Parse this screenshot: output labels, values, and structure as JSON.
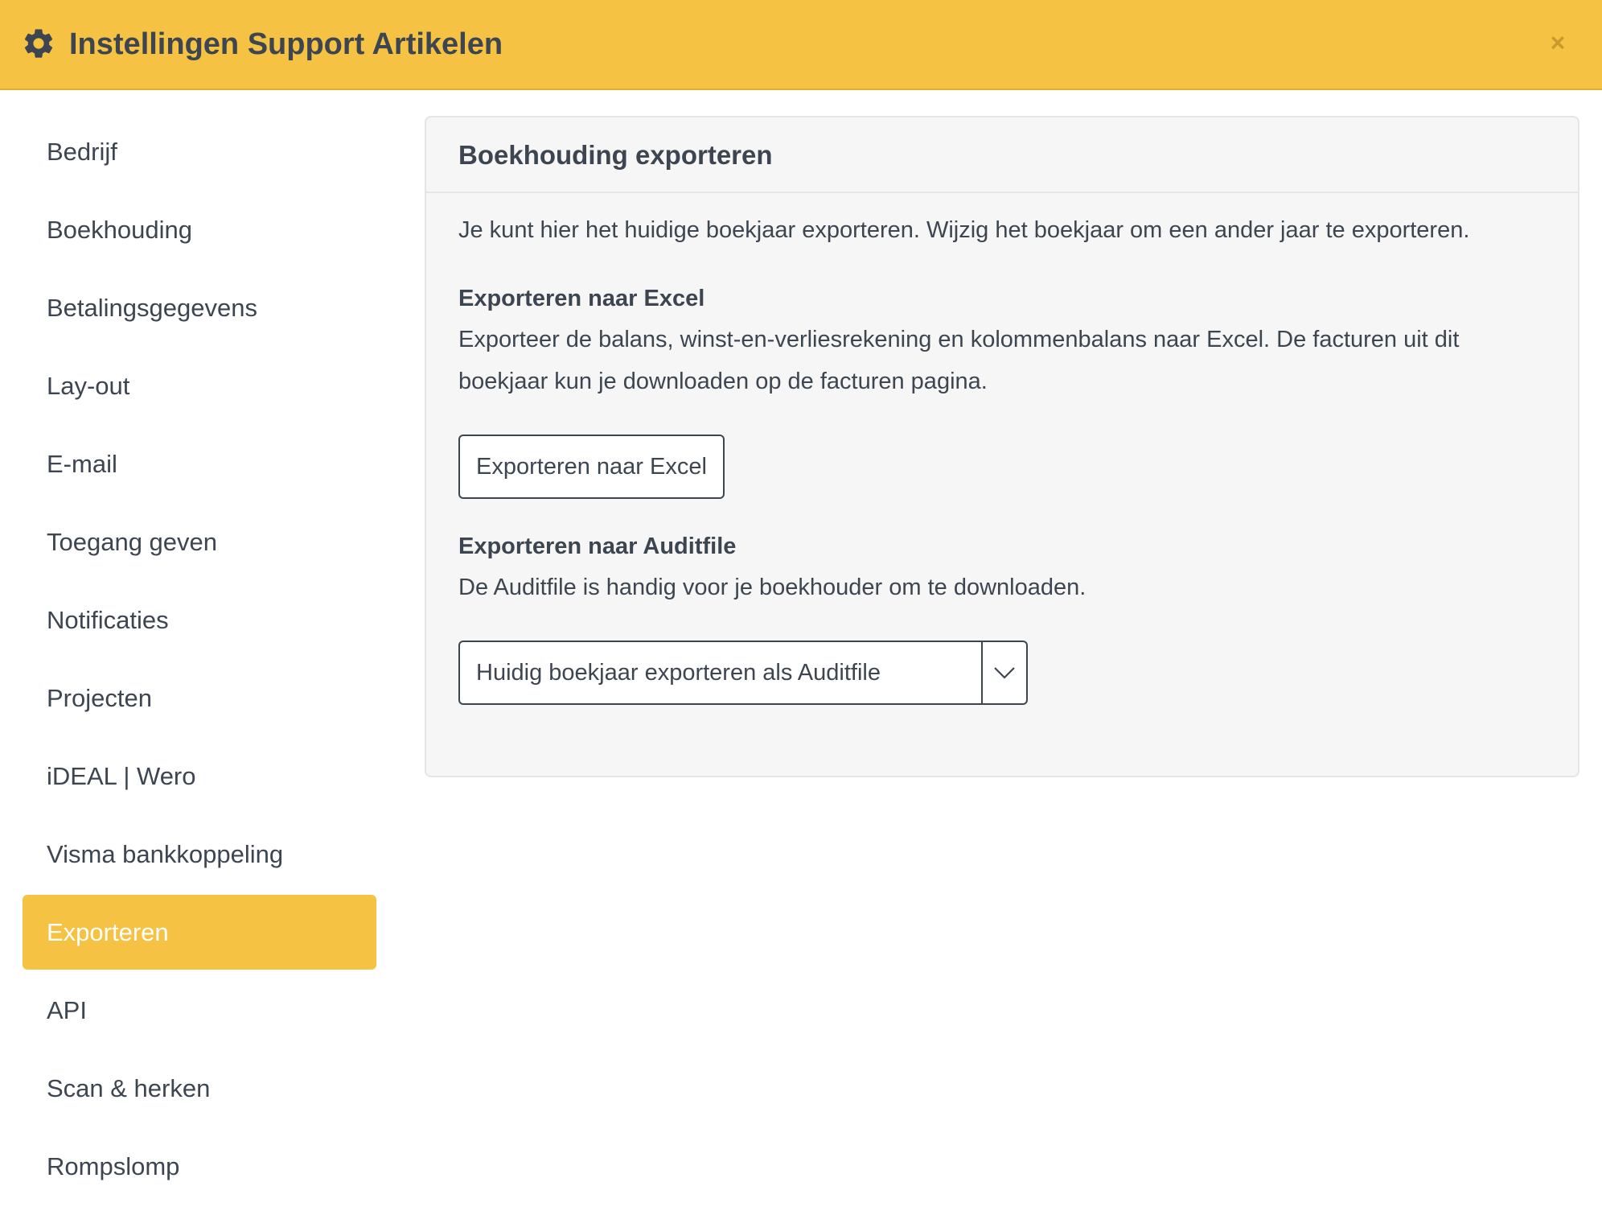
{
  "header": {
    "title": "Instellingen Support Artikelen",
    "close_label": "×",
    "gear_icon": "gear-icon",
    "close_icon": "close-icon"
  },
  "colors": {
    "accent": "#f6c244",
    "text": "#3d4650",
    "panel_bg": "#f6f6f6"
  },
  "sidebar": {
    "items": [
      {
        "label": "Bedrijf"
      },
      {
        "label": "Boekhouding"
      },
      {
        "label": "Betalingsgegevens"
      },
      {
        "label": "Lay-out"
      },
      {
        "label": "E-mail"
      },
      {
        "label": "Toegang geven"
      },
      {
        "label": "Notificaties"
      },
      {
        "label": "Projecten"
      },
      {
        "label": "iDEAL | Wero"
      },
      {
        "label": "Visma bankkoppeling"
      },
      {
        "label": "Exporteren",
        "active": true
      },
      {
        "label": "API"
      },
      {
        "label": "Scan & herken"
      },
      {
        "label": "Rompslomp"
      }
    ]
  },
  "panel": {
    "title": "Boekhouding exporteren",
    "intro": "Je kunt hier het huidige boekjaar exporteren. Wijzig het boekjaar om een ander jaar te exporteren.",
    "excel": {
      "heading": "Exporteren naar Excel",
      "description": "Exporteer de balans, winst-en-verliesrekening en kolommenbalans naar Excel. De facturen uit dit boekjaar kun je downloaden op de facturen pagina.",
      "button_label": "Exporteren naar Excel"
    },
    "auditfile": {
      "heading": "Exporteren naar Auditfile",
      "description": "De Auditfile is handig voor je boekhouder om te downloaden.",
      "button_label": "Huidig boekjaar exporteren als Auditfile",
      "toggle_icon": "chevron-down-icon"
    }
  }
}
